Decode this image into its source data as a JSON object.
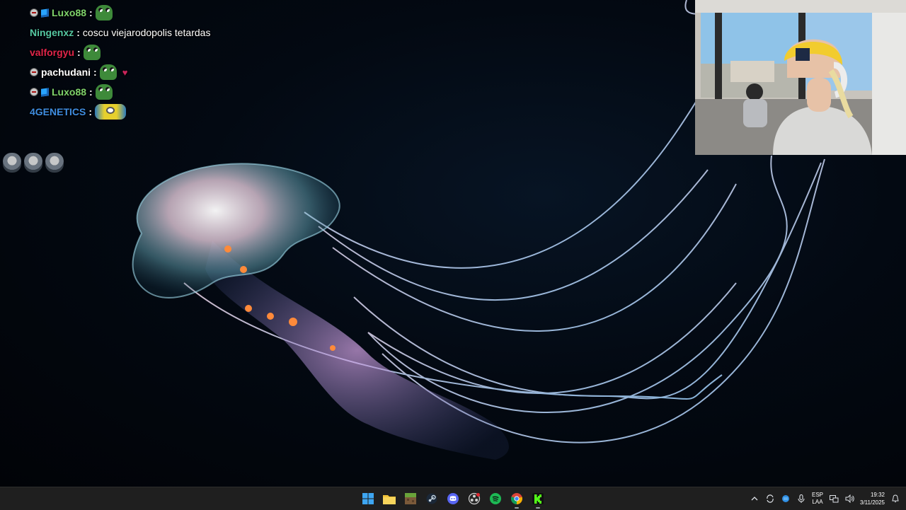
{
  "chat": {
    "messages": [
      {
        "user": "Luxo88",
        "user_color": "#7fd36b",
        "badges": [
          "moderator-badge",
          "prime-badge"
        ],
        "text": "",
        "emotes": [
          "frog-emote"
        ]
      },
      {
        "user": "Ningenxz",
        "user_color": "#55c7a2",
        "badges": [],
        "text": "coscu viejarodopolis tetardas",
        "emotes": []
      },
      {
        "user": "valforgyu",
        "user_color": "#e0254a",
        "badges": [],
        "text": "",
        "emotes": [
          "frog-emote"
        ]
      },
      {
        "user": "pachudani",
        "user_color": "#ffffff",
        "badges": [
          "moderator-badge"
        ],
        "text": "",
        "emotes": [
          "frog-emote",
          "heart-emote"
        ]
      },
      {
        "user": "Luxo88",
        "user_color": "#7fd36b",
        "badges": [
          "moderator-badge",
          "prime-badge"
        ],
        "text": "",
        "emotes": [
          "frog-emote"
        ]
      },
      {
        "user": "4GENETICS",
        "user_color": "#3f8de0",
        "badges": [],
        "text": "",
        "emotes": [
          "minion-emote"
        ]
      }
    ],
    "separator": ":"
  },
  "taskbar": {
    "apps": [
      {
        "name": "windows-start",
        "icon": "windows-logo-icon",
        "color": "#3ea6f2"
      },
      {
        "name": "file-explorer",
        "icon": "folder-icon",
        "color": "#f3c33a"
      },
      {
        "name": "minecraft",
        "icon": "minecraft-icon",
        "color": "#7c9b3e"
      },
      {
        "name": "steam",
        "icon": "steam-icon",
        "color": "#c7d5e0"
      },
      {
        "name": "discord",
        "icon": "discord-icon",
        "color": "#5865f2"
      },
      {
        "name": "obs",
        "icon": "obs-icon",
        "color": "#d0d0d0"
      },
      {
        "name": "spotify",
        "icon": "spotify-icon",
        "color": "#1db954"
      },
      {
        "name": "chrome",
        "icon": "chrome-icon",
        "color": "#4285f4"
      },
      {
        "name": "kick",
        "icon": "kick-icon",
        "color": "#53fc18"
      }
    ],
    "tray": {
      "language_top": "ESP",
      "language_bottom": "LAA",
      "time": "19:32",
      "date": "3/11/2025"
    }
  }
}
